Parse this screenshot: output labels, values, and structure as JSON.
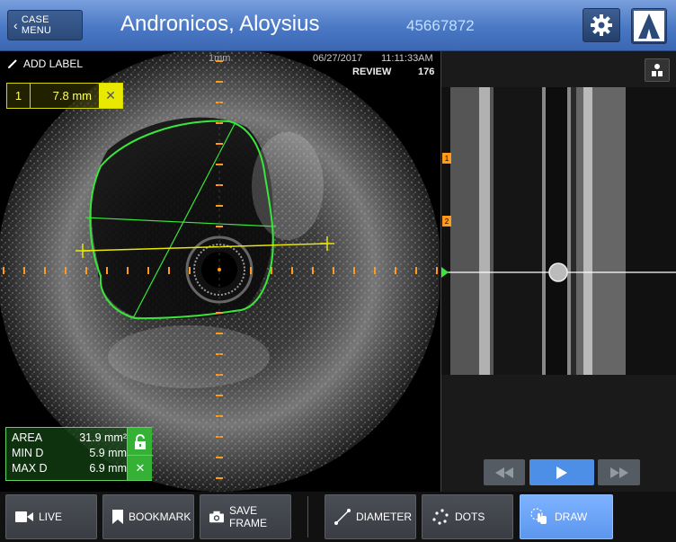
{
  "header": {
    "case_menu_label": "CASE MENU",
    "patient_name": "Andronicos, Aloysius",
    "patient_id": "45667872",
    "icons": {
      "back": "chevron-left-icon",
      "settings": "gear-icon",
      "logo": "logo-icon"
    }
  },
  "ivus": {
    "add_label": "ADD LABEL",
    "scale": "1mm",
    "date": "06/27/2017",
    "time": "11:11:33AM",
    "mode": "REVIEW",
    "frame": "176",
    "measurement": {
      "index": "1",
      "value": "7.8 mm"
    },
    "stats": {
      "area_label": "AREA",
      "area_value": "31.9 mm²",
      "min_label": "MIN D",
      "min_value": "5.9 mm",
      "max_label": "MAX D",
      "max_value": "6.9 mm"
    },
    "colors": {
      "contour": "#39e639",
      "measure": "#e8e800",
      "ticks": "#ff9a1a"
    }
  },
  "longitudinal": {
    "bookmarks": [
      "1",
      "2"
    ]
  },
  "playback": {
    "rewind_icon": "rewind-icon",
    "play_icon": "play-icon",
    "fast_forward_icon": "fast-forward-icon"
  },
  "toolbar": {
    "live_label": "LIVE",
    "bookmark_label": "BOOKMARK",
    "save_frame_label": "SAVE FRAME",
    "diameter_label": "DIAMETER",
    "dots_label": "DOTS",
    "draw_label": "DRAW",
    "accent_color": "#6aa6f8"
  }
}
